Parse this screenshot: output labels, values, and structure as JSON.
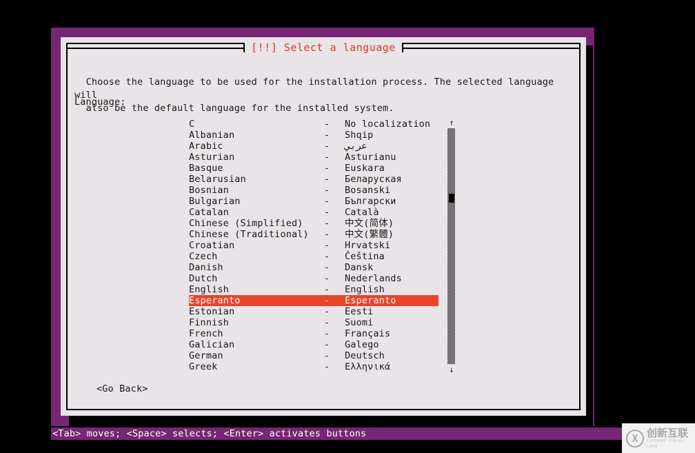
{
  "dialog": {
    "title": "[!!] Select a language",
    "title_color": "#d83a22",
    "intro": "Choose the language to be used for the installation process. The selected language will also be the default system.",
    "intro_line1": "Choose the language to be used for the installation process. The selected language will",
    "intro_line2": "also be the default language for the installed system.",
    "language_label": "Language:",
    "go_back_label": "<Go Back>",
    "background_color": "#e8e4e8",
    "frame_color": "#762672",
    "highlight_color": "#e8442a",
    "highlight_text_color": "#ffffff"
  },
  "language_list": {
    "separator": "-",
    "selected_index": 16,
    "items": [
      {
        "english": "C",
        "native": "No localization"
      },
      {
        "english": "Albanian",
        "native": "Shqip"
      },
      {
        "english": "Arabic",
        "native": "عربي"
      },
      {
        "english": "Asturian",
        "native": "Asturianu"
      },
      {
        "english": "Basque",
        "native": "Euskara"
      },
      {
        "english": "Belarusian",
        "native": "Беларуская"
      },
      {
        "english": "Bosnian",
        "native": "Bosanski"
      },
      {
        "english": "Bulgarian",
        "native": "Български"
      },
      {
        "english": "Catalan",
        "native": "Català"
      },
      {
        "english": "Chinese (Simplified)",
        "native": "中文(简体)"
      },
      {
        "english": "Chinese (Traditional)",
        "native": "中文(繁體)"
      },
      {
        "english": "Croatian",
        "native": "Hrvatski"
      },
      {
        "english": "Czech",
        "native": "Čeština"
      },
      {
        "english": "Danish",
        "native": "Dansk"
      },
      {
        "english": "Dutch",
        "native": "Nederlands"
      },
      {
        "english": "English",
        "native": "English"
      },
      {
        "english": "Esperanto",
        "native": "Esperanto"
      },
      {
        "english": "Estonian",
        "native": "Eesti"
      },
      {
        "english": "Finnish",
        "native": "Suomi"
      },
      {
        "english": "French",
        "native": "Français"
      },
      {
        "english": "Galician",
        "native": "Galego"
      },
      {
        "english": "German",
        "native": "Deutsch"
      },
      {
        "english": "Greek",
        "native": "Ελληνικά"
      }
    ]
  },
  "scrollbar": {
    "up_arrow": "↑",
    "down_arrow": "↓",
    "thumb_position_percent": 29
  },
  "status_bar": {
    "text": "<Tab> moves; <Space> selects; <Enter> activates buttons"
  },
  "watermark": {
    "mark": "X",
    "chinese": "创新互联",
    "pinyin": "CHUANG XIN HU LIAN"
  }
}
